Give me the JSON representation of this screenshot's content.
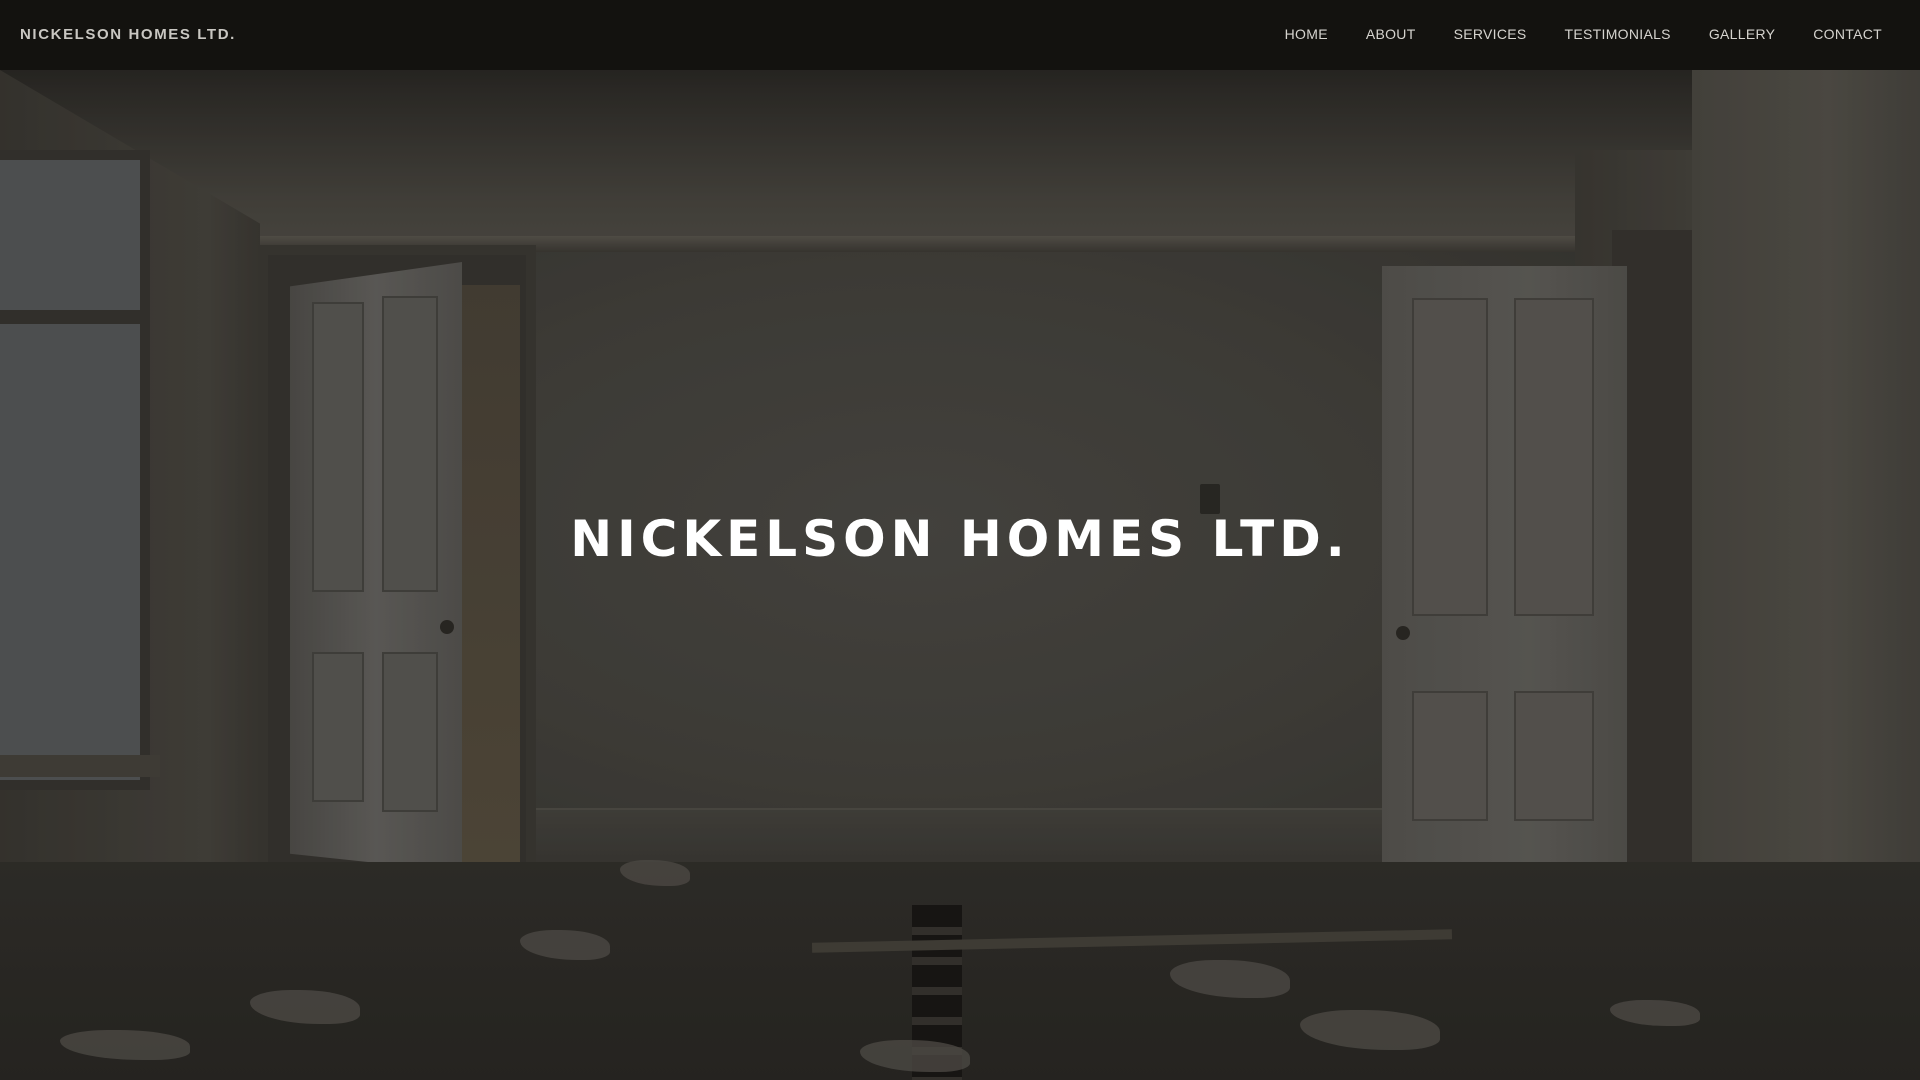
{
  "navbar": {
    "brand": "NICKELSON HOMES LTD.",
    "links": [
      {
        "label": "HOME"
      },
      {
        "label": "ABOUT"
      },
      {
        "label": "SERVICES"
      },
      {
        "label": "TESTIMONIALS"
      },
      {
        "label": "GALLERY"
      },
      {
        "label": "CONTACT"
      }
    ]
  },
  "hero": {
    "title": "NICKELSON HOMES LTD."
  },
  "colors": {
    "navbar_background": "#12110f",
    "nav_text": "#d6d4cf",
    "hero_title": "#ffffff"
  }
}
